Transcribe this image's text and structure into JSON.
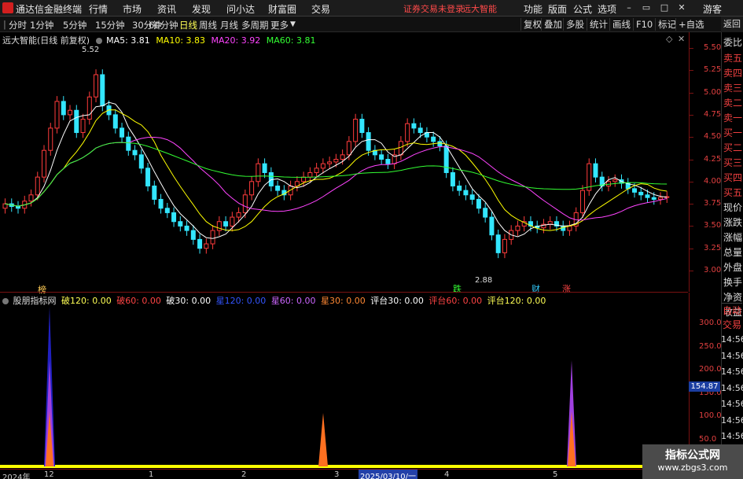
{
  "titlebar": {
    "app_name": "通达信金融终端",
    "menu": [
      "行情",
      "市场",
      "资讯",
      "发现",
      "问小达",
      "财富圈",
      "交易"
    ],
    "notice": "证券交易未登录",
    "stock_name": "远大智能",
    "right_menu": [
      "功能",
      "版面",
      "公式",
      "选项"
    ],
    "user": "游客"
  },
  "toolbar": {
    "periods": [
      "分时",
      "1分钟",
      "5分钟",
      "15分钟",
      "30分钟",
      "60分钟",
      "日线",
      "周线",
      "月线",
      "多周期",
      "更多"
    ],
    "active_period": "日线",
    "buttons": [
      "复权",
      "叠加",
      "多股",
      "统计",
      "画线",
      "F10",
      "标记",
      "+自选",
      "返回"
    ]
  },
  "main_header": {
    "title": "远大智能(日线 前复权)",
    "ma": [
      {
        "label": "MA5: 3.81",
        "color": "#ffffff"
      },
      {
        "label": "MA10: 3.83",
        "color": "#ffff00"
      },
      {
        "label": "MA20: 3.92",
        "color": "#ff44ff"
      },
      {
        "label": "MA60: 3.81",
        "color": "#33ff33"
      }
    ]
  },
  "sub_header": {
    "title": "股朋指标网",
    "items": [
      {
        "label": "破120: 0.00",
        "color": "#ffff55"
      },
      {
        "label": "破60: 0.00",
        "color": "#ff4444"
      },
      {
        "label": "破30: 0.00",
        "color": "#ffffff"
      },
      {
        "label": "星120: 0.00",
        "color": "#3355ff"
      },
      {
        "label": "星60: 0.00",
        "color": "#cc66ff"
      },
      {
        "label": "星30: 0.00",
        "color": "#ff8833"
      },
      {
        "label": "评台30: 0.00",
        "color": "#ffffff"
      },
      {
        "label": "评台60: 0.00",
        "color": "#ff4444"
      },
      {
        "label": "评台120: 0.00",
        "color": "#ffff55"
      }
    ]
  },
  "price_axis": [
    "5.50",
    "5.25",
    "5.00",
    "4.75",
    "4.50",
    "4.25",
    "4.00",
    "3.75",
    "3.50",
    "3.25",
    "3.00"
  ],
  "sub_axis": [
    "300.0",
    "250.0",
    "200.0",
    "150.0",
    "100.0",
    "50.0"
  ],
  "sub_value": "154.87",
  "annotations": {
    "high": "5.52",
    "low": "2.88"
  },
  "event_labels": [
    {
      "text": "榜",
      "color": "#ffcc55"
    },
    {
      "text": "跌",
      "color": "#33ff33"
    },
    {
      "text": "财",
      "color": "#33ccff"
    },
    {
      "text": "涨",
      "color": "#ff4444"
    }
  ],
  "sidebar": [
    "委比",
    "卖五",
    "卖四",
    "卖三",
    "卖二",
    "卖一",
    "买一",
    "买二",
    "买三",
    "买四",
    "买五",
    "现价",
    "涨跌",
    "涨幅",
    "总量",
    "外盘",
    "换手",
    "净资",
    "收益"
  ],
  "sidebar_lower": [
    "自动",
    "交易"
  ],
  "time_column": [
    "14:56",
    "14:56",
    "14:56",
    "14:56",
    "14:56",
    "14:56",
    "14:56",
    "14:56",
    "14:56"
  ],
  "bottom_dates": [
    "2024年",
    "12",
    "1",
    "2",
    "3",
    "4",
    "5"
  ],
  "bottom_selected": "2025/03/10/一",
  "watermark": {
    "title": "指标公式网",
    "url": "www.zbgs3.com"
  }
}
